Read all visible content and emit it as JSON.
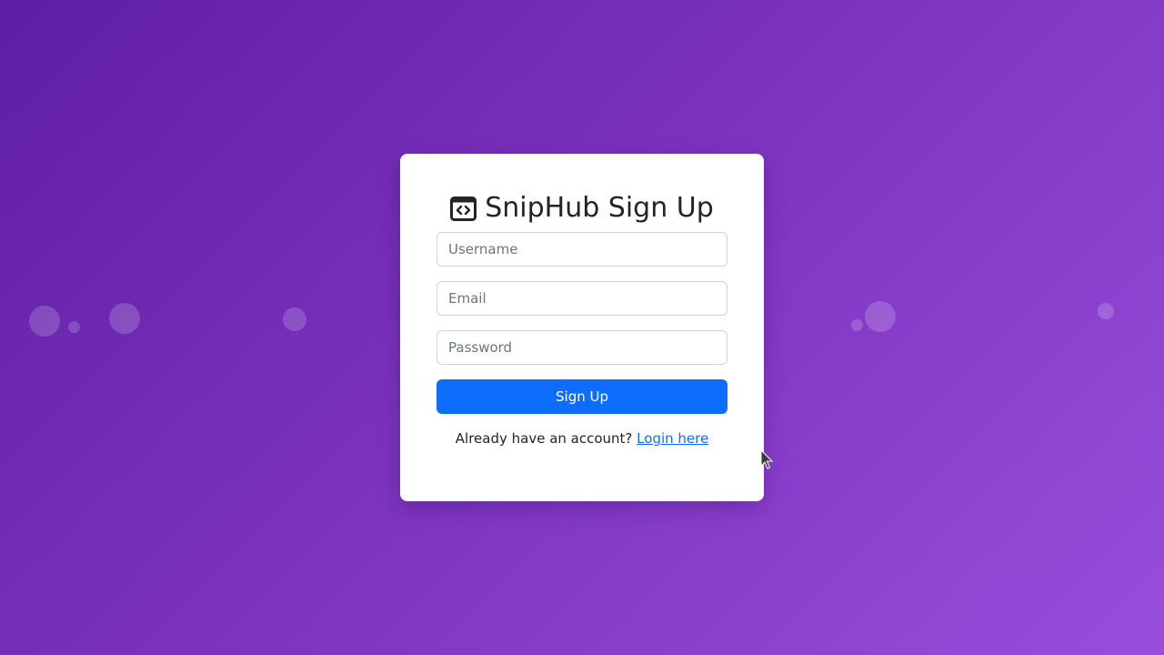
{
  "app": {
    "title": "SnipHub Sign Up",
    "icon": "code-window-icon"
  },
  "form": {
    "username_placeholder": "Username",
    "username_value": "",
    "email_placeholder": "Email",
    "email_value": "",
    "password_placeholder": "Password",
    "password_value": "",
    "submit_label": "Sign Up"
  },
  "footer": {
    "prompt": "Already have an account?",
    "login_link": "Login here"
  },
  "colors": {
    "background_start": "#5f1ea3",
    "background_end": "#9a4ddc",
    "primary_button": "#0d6efd",
    "link": "#0d6efd",
    "card": "#ffffff"
  }
}
